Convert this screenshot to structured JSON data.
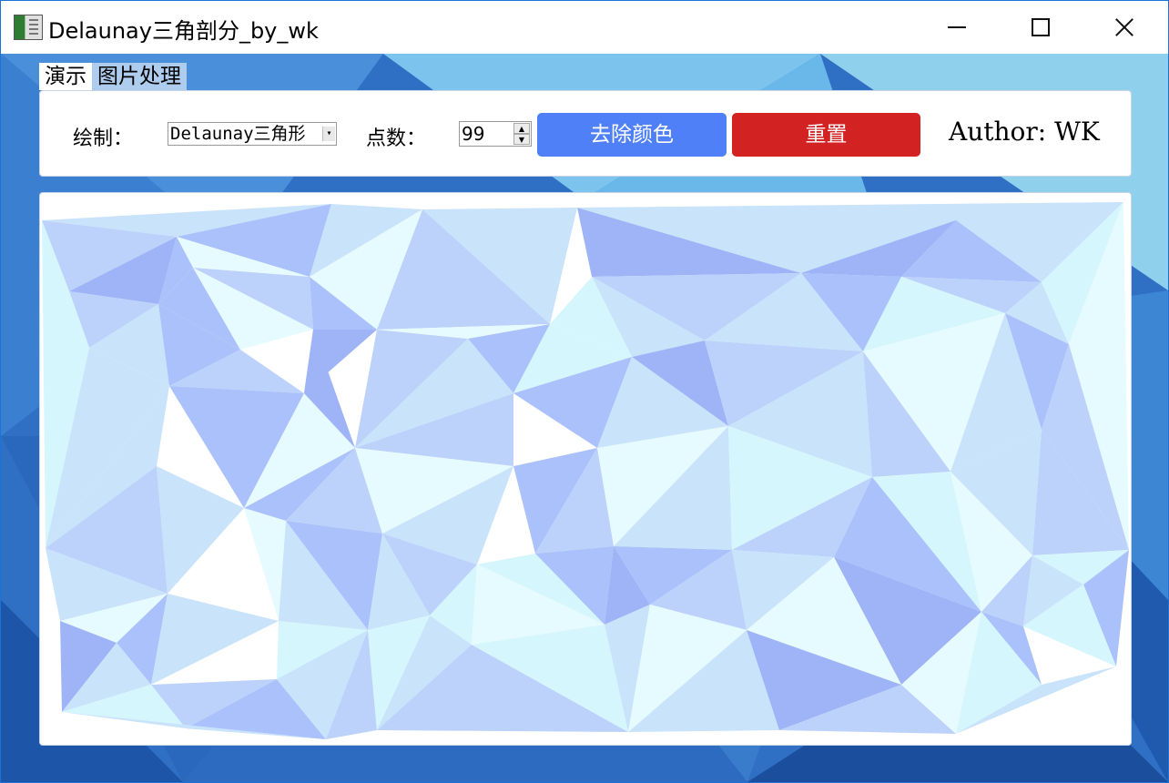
{
  "window": {
    "title": "Delaunay三角剖分_by_wk",
    "controls": {
      "minimize": "minimize-icon",
      "maximize": "maximize-icon",
      "close": "close-icon"
    }
  },
  "menu": {
    "items": [
      {
        "label": "演示",
        "active": true
      },
      {
        "label": "图片处理",
        "active": false
      }
    ]
  },
  "toolbar": {
    "draw_label": "绘制：",
    "draw_select_value": "Delaunay三角形",
    "points_label": "点数：",
    "points_value": "99",
    "remove_color_label": "去除颜色",
    "reset_label": "重置",
    "author": "Author: WK"
  },
  "colors": {
    "accent_blue": "#4f80f7",
    "reset_red": "#d22222",
    "triangle_palette": [
      "#e6fbff",
      "#d6f6fd",
      "#c9e3fb",
      "#bcd2fb",
      "#abc1fb",
      "#9fb3f7"
    ]
  }
}
